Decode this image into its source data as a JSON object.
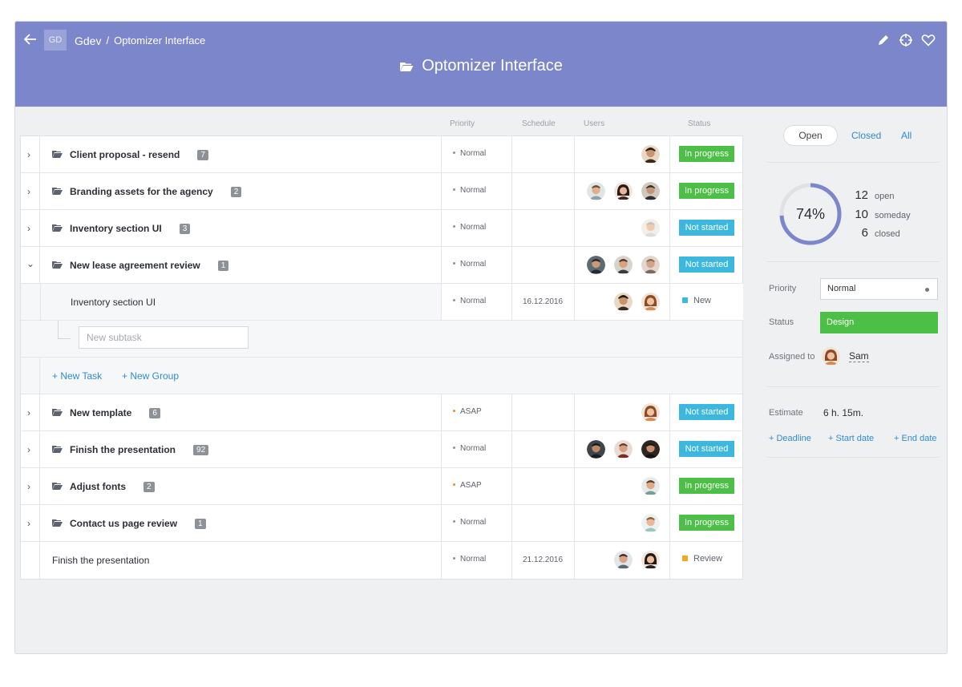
{
  "header": {
    "workspace_badge": "GD",
    "breadcrumb": [
      "Gdev",
      "/",
      "Optomizer Interface"
    ],
    "title": "Optomizer Interface"
  },
  "columns": {
    "priority": "Priority",
    "schedule": "Schedule",
    "users": "Users",
    "status": "Status"
  },
  "tasks": [
    {
      "name": "Client proposal - resend",
      "count": "7",
      "priority": "Normal",
      "schedule": "",
      "status": "In progress"
    },
    {
      "name": "Branding assets for the agency",
      "count": "2",
      "priority": "Normal",
      "schedule": "",
      "status": "In progress"
    },
    {
      "name": "Inventory section UI",
      "count": "3",
      "priority": "Normal",
      "schedule": "",
      "status": "Not started"
    },
    {
      "name": "New lease agreement review",
      "count": "1",
      "priority": "Normal",
      "schedule": "",
      "status": "Not started"
    },
    {
      "name": "Inventory section UI",
      "priority": "Normal",
      "schedule": "16.12.2016",
      "status": "New"
    },
    {
      "name": "New template",
      "count": "6",
      "priority": "ASAP",
      "schedule": "",
      "status": "Not started"
    },
    {
      "name": "Finish the presentation",
      "count": "92",
      "priority": "Normal",
      "schedule": "",
      "status": "Not started"
    },
    {
      "name": "Adjust fonts",
      "count": "2",
      "priority": "ASAP",
      "schedule": "",
      "status": "In progress"
    },
    {
      "name": "Contact us page review",
      "count": "1",
      "priority": "Normal",
      "schedule": "",
      "status": "In progress"
    },
    {
      "name": "Finish the presentation",
      "priority": "Normal",
      "schedule": "21.12.2016",
      "status": "Review"
    }
  ],
  "new_subtask_placeholder": "New subtask",
  "add_links": {
    "task": "+ New Task",
    "group": "+ New Group"
  },
  "sidebar": {
    "filters": {
      "open": "Open",
      "closed": "Closed",
      "all": "All"
    },
    "progress_label": "74%",
    "progress_value": 0.74,
    "stats": [
      {
        "value": "12",
        "label": "open"
      },
      {
        "value": "10",
        "label": "someday"
      },
      {
        "value": "6",
        "label": "closed"
      }
    ],
    "priority_label": "Priority",
    "priority_value": "Normal",
    "status_label": "Status",
    "status_value": "Design",
    "assigned_label": "Assigned to",
    "assignee": "Sam",
    "estimate_label": "Estimate",
    "estimate_value": "6 h. 15m.",
    "links": {
      "deadline": "+ Deadline",
      "start": "+ Start date",
      "end": "+ End date"
    }
  },
  "colors": {
    "header": "#7b86cb",
    "in_progress": "#4cbf46",
    "not_started": "#3cb8df",
    "new": "#3cb8df",
    "review": "#f5a623",
    "asap": "#f08a24",
    "link": "#2f8bcf"
  }
}
